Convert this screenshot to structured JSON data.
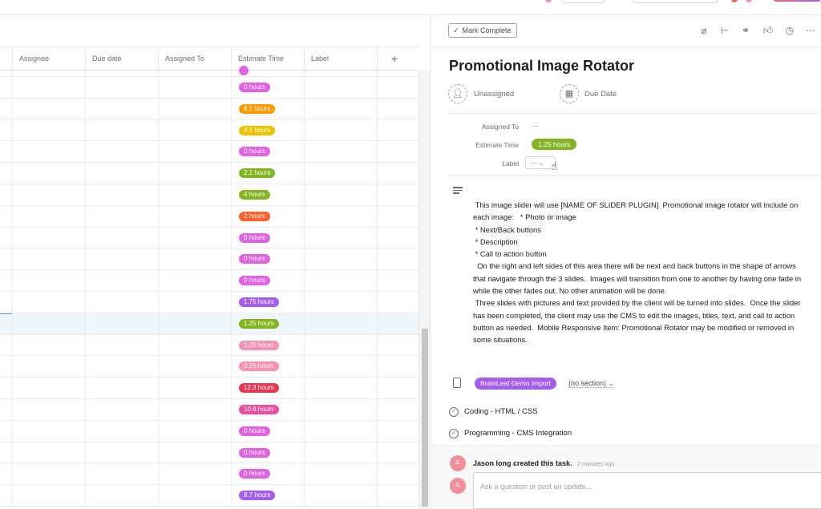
{
  "grid": {
    "headers": [
      "Assignee",
      "Due date",
      "Assigned To",
      "Estimate Time",
      "Label"
    ],
    "add_column": "+",
    "rows": [
      {
        "estimate": "",
        "color": "#e362e3"
      },
      {
        "estimate": "0 hours",
        "color": "#e362e3"
      },
      {
        "estimate": "8.1 hours",
        "color": "#fd9a00"
      },
      {
        "estimate": "4.1 hours",
        "color": "#eec300"
      },
      {
        "estimate": "0 hours",
        "color": "#e362e3"
      },
      {
        "estimate": "2.1 hours",
        "color": "#83b521"
      },
      {
        "estimate": "4 hours",
        "color": "#83b521"
      },
      {
        "estimate": "2 hours",
        "color": "#fd612c"
      },
      {
        "estimate": "0 hours",
        "color": "#e362e3"
      },
      {
        "estimate": "0 hours",
        "color": "#e362e3"
      },
      {
        "estimate": "0 hours",
        "color": "#e362e3"
      },
      {
        "estimate": "1.75 hours",
        "color": "#a55df0"
      },
      {
        "estimate": "1.25 hours",
        "color": "#83b521",
        "selected": true
      },
      {
        "estimate": "0.25 hours",
        "color": "#fa91ae"
      },
      {
        "estimate": "0.25 hours",
        "color": "#fa91ae"
      },
      {
        "estimate": "12.3 hours",
        "color": "#e8384f"
      },
      {
        "estimate": "10.8 hours",
        "color": "#ea4e9d"
      },
      {
        "estimate": "0 hours",
        "color": "#e362e3"
      },
      {
        "estimate": "0 hours",
        "color": "#e362e3"
      },
      {
        "estimate": "0 hours",
        "color": "#e362e3"
      },
      {
        "estimate": "8.7 hours",
        "color": "#a55df0"
      }
    ]
  },
  "panel": {
    "mark_complete": "Mark Complete",
    "toolbar_icons": [
      "attach-icon",
      "subtask-icon",
      "link-icon",
      "like-icon",
      "timer-icon",
      "more-icon"
    ],
    "title": "Promotional Image Rotator",
    "assignee": "Unassigned",
    "due_date": "Due Date",
    "fields": {
      "assigned_to_label": "Assigned To",
      "assigned_to_value": "—",
      "estimate_label": "Estimate Time",
      "estimate_value": "1.25 hours",
      "label_label": "Label",
      "label_value": "—"
    },
    "description": " This image slider will use [NAME OF SLIDER PLUGIN]  Promotional image rotator will include on\neach image:   * Photo or image\n * Next/Back buttons\n * Description\n * Call to action button\n  On the right and left sides of this area there will be next and back buttons in the shape of arrows\nthat navigate through the 3 slides.  Images will transition from one to another by having one fade in\nwhile the other fades out. No other animation will be done.\n Three slides with pictures and text provided by the client will be turned into slides.  Once the slider\nhas been completed, the client may use the CMS to edit the images, titles, text, and call to action\nbutton as needed.  Mobile Responsive Item: Promotional Rotator may be modified or removed in\nsome situations.",
    "project": "BrainLeaf Demo Import",
    "section": "(no section)",
    "subtasks": [
      "Coding - HTML / CSS",
      "Programming - CMS Integration"
    ],
    "activity_user": "Jason long",
    "activity_action": "created this task.",
    "activity_time": "2 minutes ago",
    "avatar_initials": "JL",
    "comment_placeholder": "Ask a question or post an update..."
  }
}
